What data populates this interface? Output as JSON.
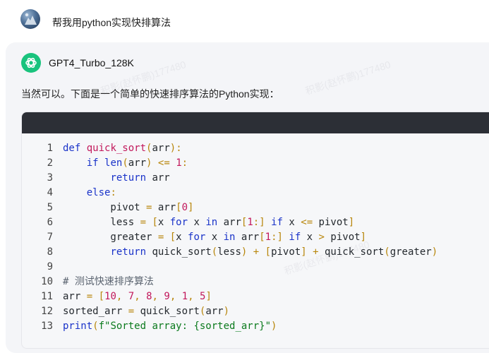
{
  "user": {
    "avatar_icon": "user-avatar-photo",
    "message": "帮我用python实现快排算法"
  },
  "assistant": {
    "icon": "openai-logo-icon",
    "icon_color": "#19c37d",
    "name": "GPT4_Turbo_128K",
    "intro": "当然可以。下面是一个简单的快速排序算法的Python实现："
  },
  "watermark_text": "积影(赵怀鹏)177480",
  "code": {
    "language": "python",
    "lines": [
      "def quick_sort(arr):",
      "    if len(arr) <= 1:",
      "        return arr",
      "    else:",
      "        pivot = arr[0]",
      "        less = [x for x in arr[1:] if x <= pivot]",
      "        greater = [x for x in arr[1:] if x > pivot]",
      "        return quick_sort(less) + [pivot] + quick_sort(greater)",
      "",
      "# 测试快速排序算法",
      "arr = [10, 7, 8, 9, 1, 5]",
      "sorted_arr = quick_sort(arr)",
      "print(f\"Sorted array: {sorted_arr}\")"
    ]
  }
}
